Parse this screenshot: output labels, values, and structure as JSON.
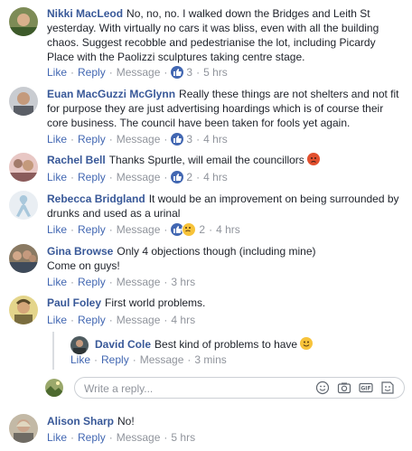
{
  "action_labels": {
    "like": "Like",
    "reply": "Reply",
    "message": "Message"
  },
  "comments": [
    {
      "author": "Nikki MacLeod",
      "text": "No, no, no. I walked down the Bridges and Leith St yesterday. With virtually no cars it was bliss, even with all the building chaos. Suggest recobble and pedestrianise the lot, including Picardy Place with the Paolizzi sculptures taking centre stage.",
      "reactions": "3",
      "time": "5 hrs"
    },
    {
      "author": "Euan MacGuzzi McGlynn",
      "text": "Really these things are not shelters and not fit for purpose they are just advertising hoardings which is of course their core business. The council have been taken for fools yet again.",
      "reactions": "3",
      "time": "4 hrs"
    },
    {
      "author": "Rachel Bell",
      "text": "Thanks Spurtle, will email the councillors",
      "reactions": "2",
      "time": "4 hrs"
    },
    {
      "author": "Rebecca Bridgland",
      "text": "It would be an improvement on being surrounded by drunks and used as a urinal",
      "reactions": "2",
      "time": "4 hrs"
    },
    {
      "author": "Gina Browse",
      "text": "Only 4 objections though (including mine)",
      "text2": "Come on guys!",
      "time": "3 hrs"
    },
    {
      "author": "Paul Foley",
      "text": "First world problems.",
      "time": "4 hrs"
    },
    {
      "author": "David Cole",
      "text": "Best kind of problems to have",
      "time": "3 mins"
    },
    {
      "author": "Alison Sharp",
      "text": "No!",
      "time": "5 hrs"
    }
  ],
  "reply_box": {
    "placeholder": "Write a reply..."
  },
  "colors": {
    "link": "#385898",
    "action": "#4267b2",
    "meta": "#90949c",
    "text": "#1d2129"
  }
}
